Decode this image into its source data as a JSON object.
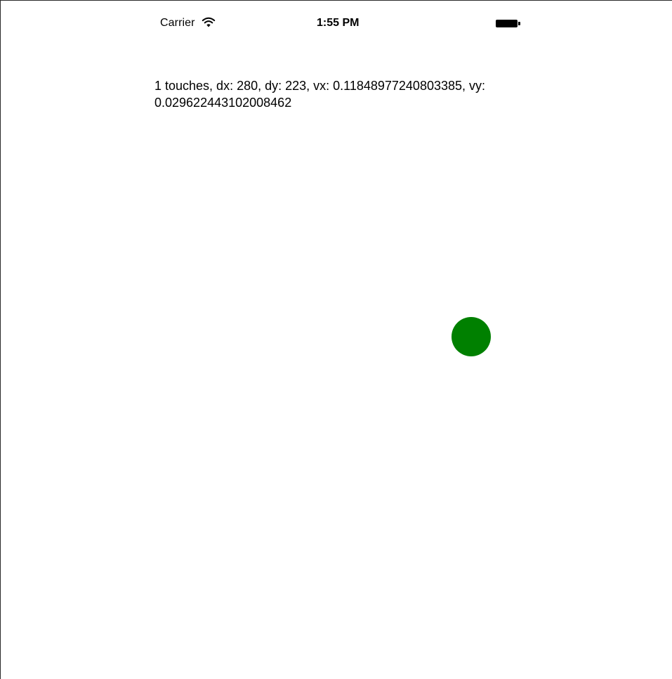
{
  "status_bar": {
    "carrier": "Carrier",
    "signal_icon": "wifi-icon",
    "time": "1:55 PM",
    "battery_icon": "battery-icon"
  },
  "touch_readout": {
    "text": "1 touches, dx: 280, dy: 223, vx: 0.11848977240803385, vy: 0.029622443102008462"
  },
  "touch_marker": {
    "color": "#008000"
  }
}
